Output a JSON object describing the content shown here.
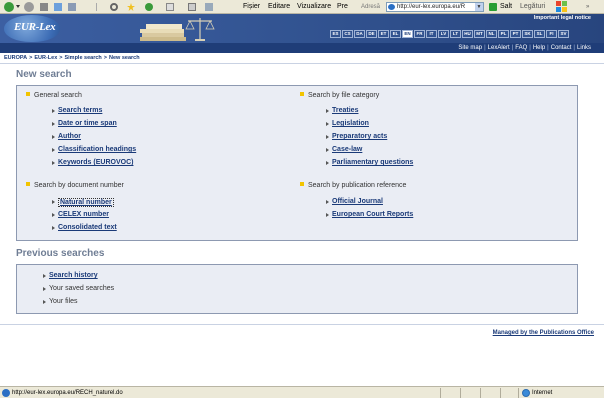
{
  "browser": {
    "menu": [
      "Fișier",
      "Editare",
      "Vizualizare",
      "Pre"
    ],
    "address_label": "Adresă",
    "address_value": "http://eur-lex.europa.eu/R",
    "go_label": "Salt",
    "links_label": "Legături"
  },
  "banner": {
    "logo_text": "EUR-Lex",
    "legal_notice": "Important legal notice",
    "languages": [
      "ES",
      "CS",
      "DA",
      "DE",
      "ET",
      "EL",
      "EN",
      "FR",
      "IT",
      "LV",
      "LT",
      "HU",
      "MT",
      "NL",
      "PL",
      "PT",
      "SK",
      "SL",
      "FI",
      "SV"
    ],
    "active_language": "EN",
    "util_links": [
      "Site map",
      "LexAlert",
      "FAQ",
      "Help",
      "Contact",
      "Links"
    ]
  },
  "breadcrumb": [
    "EUROPA",
    "EUR-Lex",
    "Simple search",
    "New search"
  ],
  "new_search": {
    "title": "New search",
    "general": {
      "heading": "General search",
      "items": [
        "Search terms",
        "Date or time span",
        "Author",
        "Classification headings",
        "Keywords (EUROVOC)"
      ]
    },
    "file_category": {
      "heading": "Search by file category",
      "items": [
        "Treaties",
        "Legislation",
        "Preparatory acts",
        "Case-law",
        "Parliamentary questions"
      ]
    },
    "document_number": {
      "heading": "Search by document number",
      "items": [
        "Natural number",
        "CELEX number",
        "Consolidated text"
      ]
    },
    "publication": {
      "heading": "Search by publication reference",
      "items": [
        "Official Journal",
        "European Court Reports"
      ]
    }
  },
  "previous": {
    "title": "Previous searches",
    "items": [
      "Search history",
      "Your saved searches",
      "Your files"
    ]
  },
  "footer": {
    "managed_by": "Managed by the Publications Office"
  },
  "status": {
    "url": "http://eur-lex.europa.eu/RECH_naturel.do",
    "zone": "Internet"
  },
  "colors": {
    "banner": "#31528f",
    "link": "#1a3a78",
    "panel": "#eaedf4",
    "bullet": "#f2c400",
    "title_gray": "#6f7d94"
  }
}
